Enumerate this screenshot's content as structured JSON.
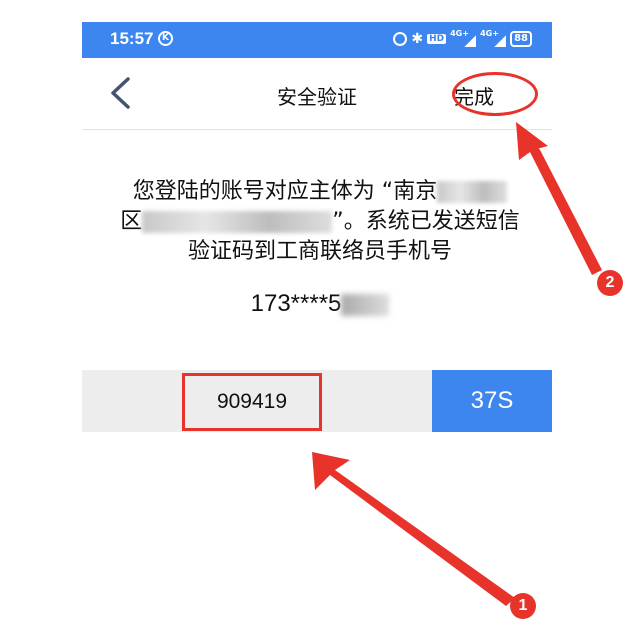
{
  "status_bar": {
    "time": "15:57",
    "k_icon_label": "K",
    "hd_label": "HD",
    "signal1_label": "4G+",
    "signal2_label": "4G+",
    "battery": "88"
  },
  "header": {
    "title": "安全验证",
    "done_label": "完成"
  },
  "message": {
    "line1_prefix": "您登陆的账号对应主体为 “南京",
    "line2_prefix": "区",
    "line2_suffix": "”。系统已发送短信",
    "line3": "验证码到工商联络员手机号"
  },
  "phone": {
    "visible_prefix": "173****5"
  },
  "verify": {
    "code_value": "909419",
    "countdown": "37S"
  },
  "annotations": {
    "badge_1": "1",
    "badge_2": "2",
    "accent_color": "#e8332b"
  },
  "theme": {
    "primary": "#3d86f0",
    "input_bg": "#ededed"
  }
}
